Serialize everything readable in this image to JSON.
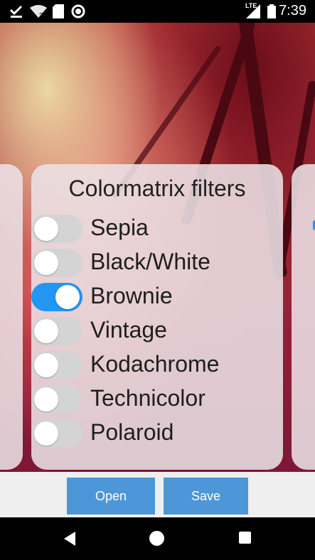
{
  "status_bar": {
    "time": "7:39",
    "network": "LTE",
    "icons": [
      "download-done-icon",
      "wifi-unknown-icon",
      "sd-card-icon",
      "record-icon",
      "signal-icon",
      "battery-icon"
    ]
  },
  "filter_card": {
    "title": "Colormatrix filters",
    "filters": [
      {
        "label": "Sepia",
        "enabled": false
      },
      {
        "label": "Black/White",
        "enabled": false
      },
      {
        "label": "Brownie",
        "enabled": true
      },
      {
        "label": "Vintage",
        "enabled": false
      },
      {
        "label": "Kodachrome",
        "enabled": false
      },
      {
        "label": "Technicolor",
        "enabled": false
      },
      {
        "label": "Polaroid",
        "enabled": false
      }
    ]
  },
  "actions": {
    "open_label": "Open",
    "save_label": "Save"
  },
  "colors": {
    "accent": "#2196f3",
    "button": "#4d97d9"
  }
}
